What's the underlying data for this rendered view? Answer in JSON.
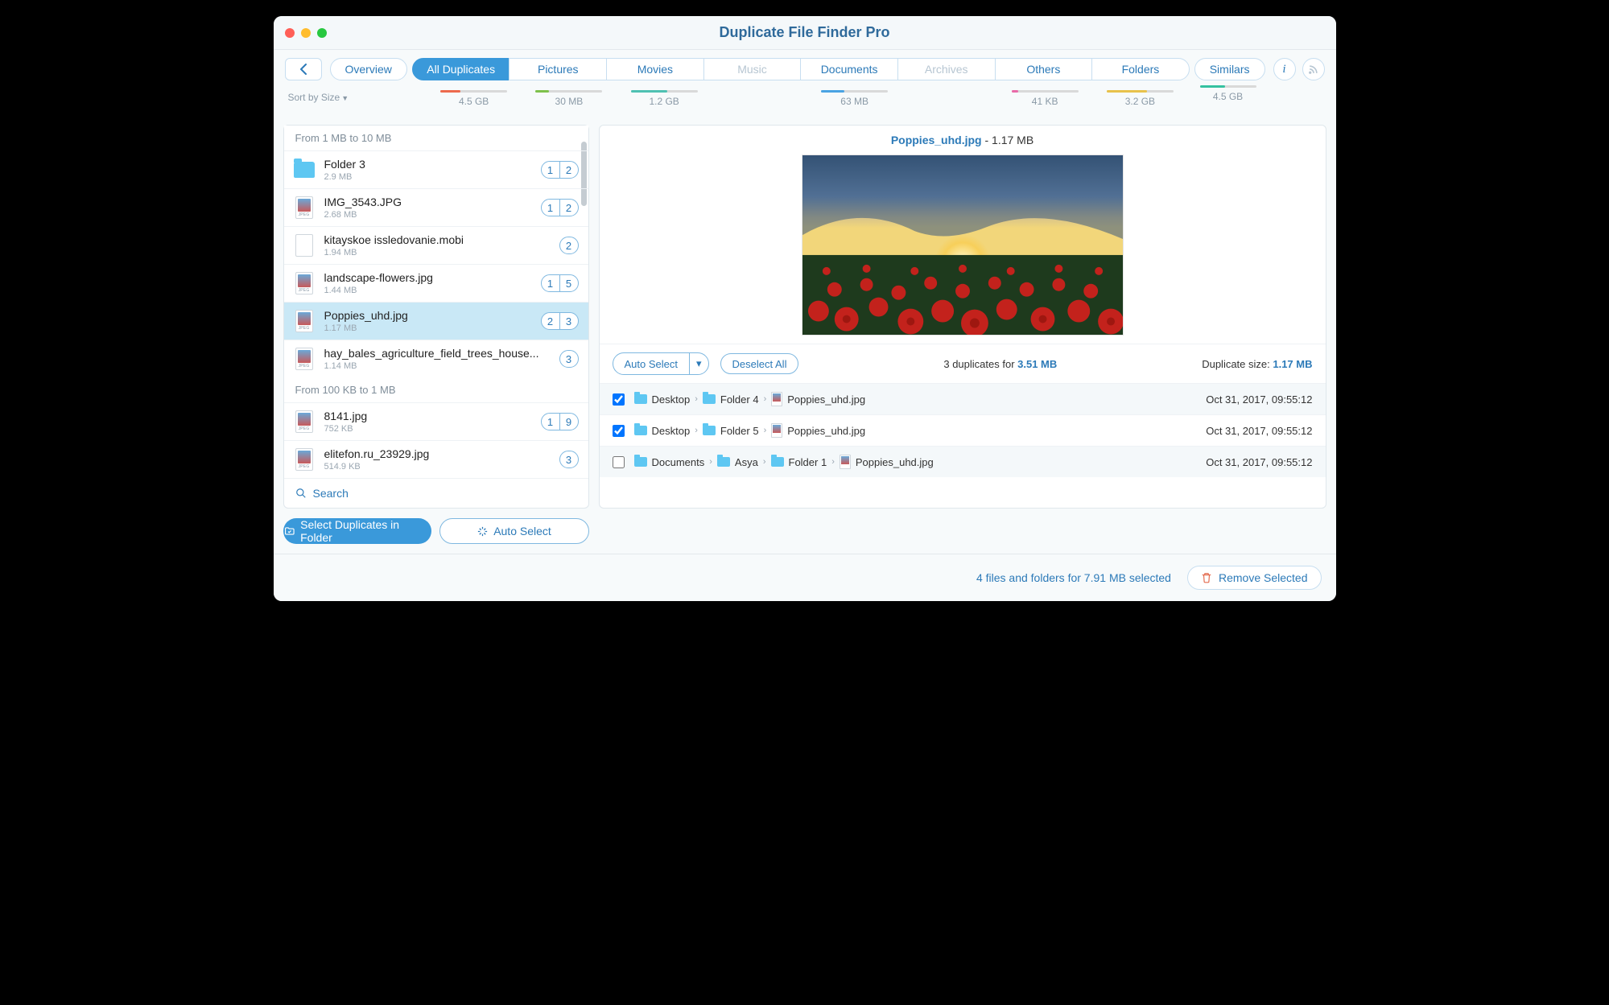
{
  "window": {
    "title": "Duplicate File Finder Pro"
  },
  "toolbar": {
    "overview": "Overview",
    "similars": "Similars",
    "sort_label": "Sort by Size",
    "categories": [
      {
        "label": "All Duplicates",
        "size": "4.5 GB",
        "selected": true,
        "bar": "bar-red"
      },
      {
        "label": "Pictures",
        "size": "30 MB",
        "selected": false,
        "bar": "bar-green"
      },
      {
        "label": "Movies",
        "size": "1.2 GB",
        "selected": false,
        "bar": "bar-teal"
      },
      {
        "label": "Music",
        "size": "",
        "selected": false,
        "bar": "",
        "disabled": true
      },
      {
        "label": "Documents",
        "size": "63 MB",
        "selected": false,
        "bar": "bar-blue"
      },
      {
        "label": "Archives",
        "size": "",
        "selected": false,
        "bar": "",
        "disabled": true
      },
      {
        "label": "Others",
        "size": "41 KB",
        "selected": false,
        "bar": "bar-pink"
      },
      {
        "label": "Folders",
        "size": "3.2 GB",
        "selected": false,
        "bar": "bar-yellow"
      }
    ],
    "similars_size": "4.5 GB"
  },
  "left": {
    "groups": [
      {
        "header": "From 1 MB to 10 MB",
        "items": [
          {
            "name": "Folder 3",
            "size": "2.9 MB",
            "type": "folder",
            "badges": [
              "1",
              "2"
            ]
          },
          {
            "name": "IMG_3543.JPG",
            "size": "2.68 MB",
            "type": "jpeg",
            "badges": [
              "1",
              "2"
            ]
          },
          {
            "name": "kitayskoe issledovanie.mobi",
            "size": "1.94 MB",
            "type": "doc",
            "badges": [
              "2"
            ]
          },
          {
            "name": "landscape-flowers.jpg",
            "size": "1.44 MB",
            "type": "jpeg",
            "badges": [
              "1",
              "5"
            ]
          },
          {
            "name": "Poppies_uhd.jpg",
            "size": "1.17 MB",
            "type": "jpeg",
            "badges": [
              "2",
              "3"
            ],
            "selected": true
          },
          {
            "name": "hay_bales_agriculture_field_trees_house...",
            "size": "1.14 MB",
            "type": "jpeg",
            "badges": [
              "3"
            ]
          }
        ]
      },
      {
        "header": "From 100 KB to 1 MB",
        "items": [
          {
            "name": "8141.jpg",
            "size": "752 KB",
            "type": "jpeg",
            "badges": [
              "1",
              "9"
            ]
          },
          {
            "name": "elitefon.ru_23929.jpg",
            "size": "514.9 KB",
            "type": "jpeg",
            "badges": [
              "3"
            ]
          }
        ]
      }
    ],
    "search": "Search",
    "select_in_folder": "Select Duplicates in Folder",
    "auto_select": "Auto Select"
  },
  "preview": {
    "filename": "Poppies_uhd.jpg",
    "filesize": "1.17 MB",
    "auto_select": "Auto Select",
    "deselect_all": "Deselect All",
    "summary_pre": "3 duplicates for ",
    "summary_bold": "3.51 MB",
    "size_label": "Duplicate size: ",
    "size_bold": "1.17 MB",
    "rows": [
      {
        "checked": true,
        "path": [
          "Desktop",
          "Folder 4",
          "Poppies_uhd.jpg"
        ],
        "date": "Oct 31, 2017, 09:55:12"
      },
      {
        "checked": true,
        "path": [
          "Desktop",
          "Folder 5",
          "Poppies_uhd.jpg"
        ],
        "date": "Oct 31, 2017, 09:55:12"
      },
      {
        "checked": false,
        "path": [
          "Documents",
          "Asya",
          "Folder 1",
          "Poppies_uhd.jpg"
        ],
        "date": "Oct 31, 2017, 09:55:12"
      }
    ]
  },
  "footer": {
    "summary": "4 files and folders for 7.91 MB selected",
    "remove": "Remove Selected"
  }
}
